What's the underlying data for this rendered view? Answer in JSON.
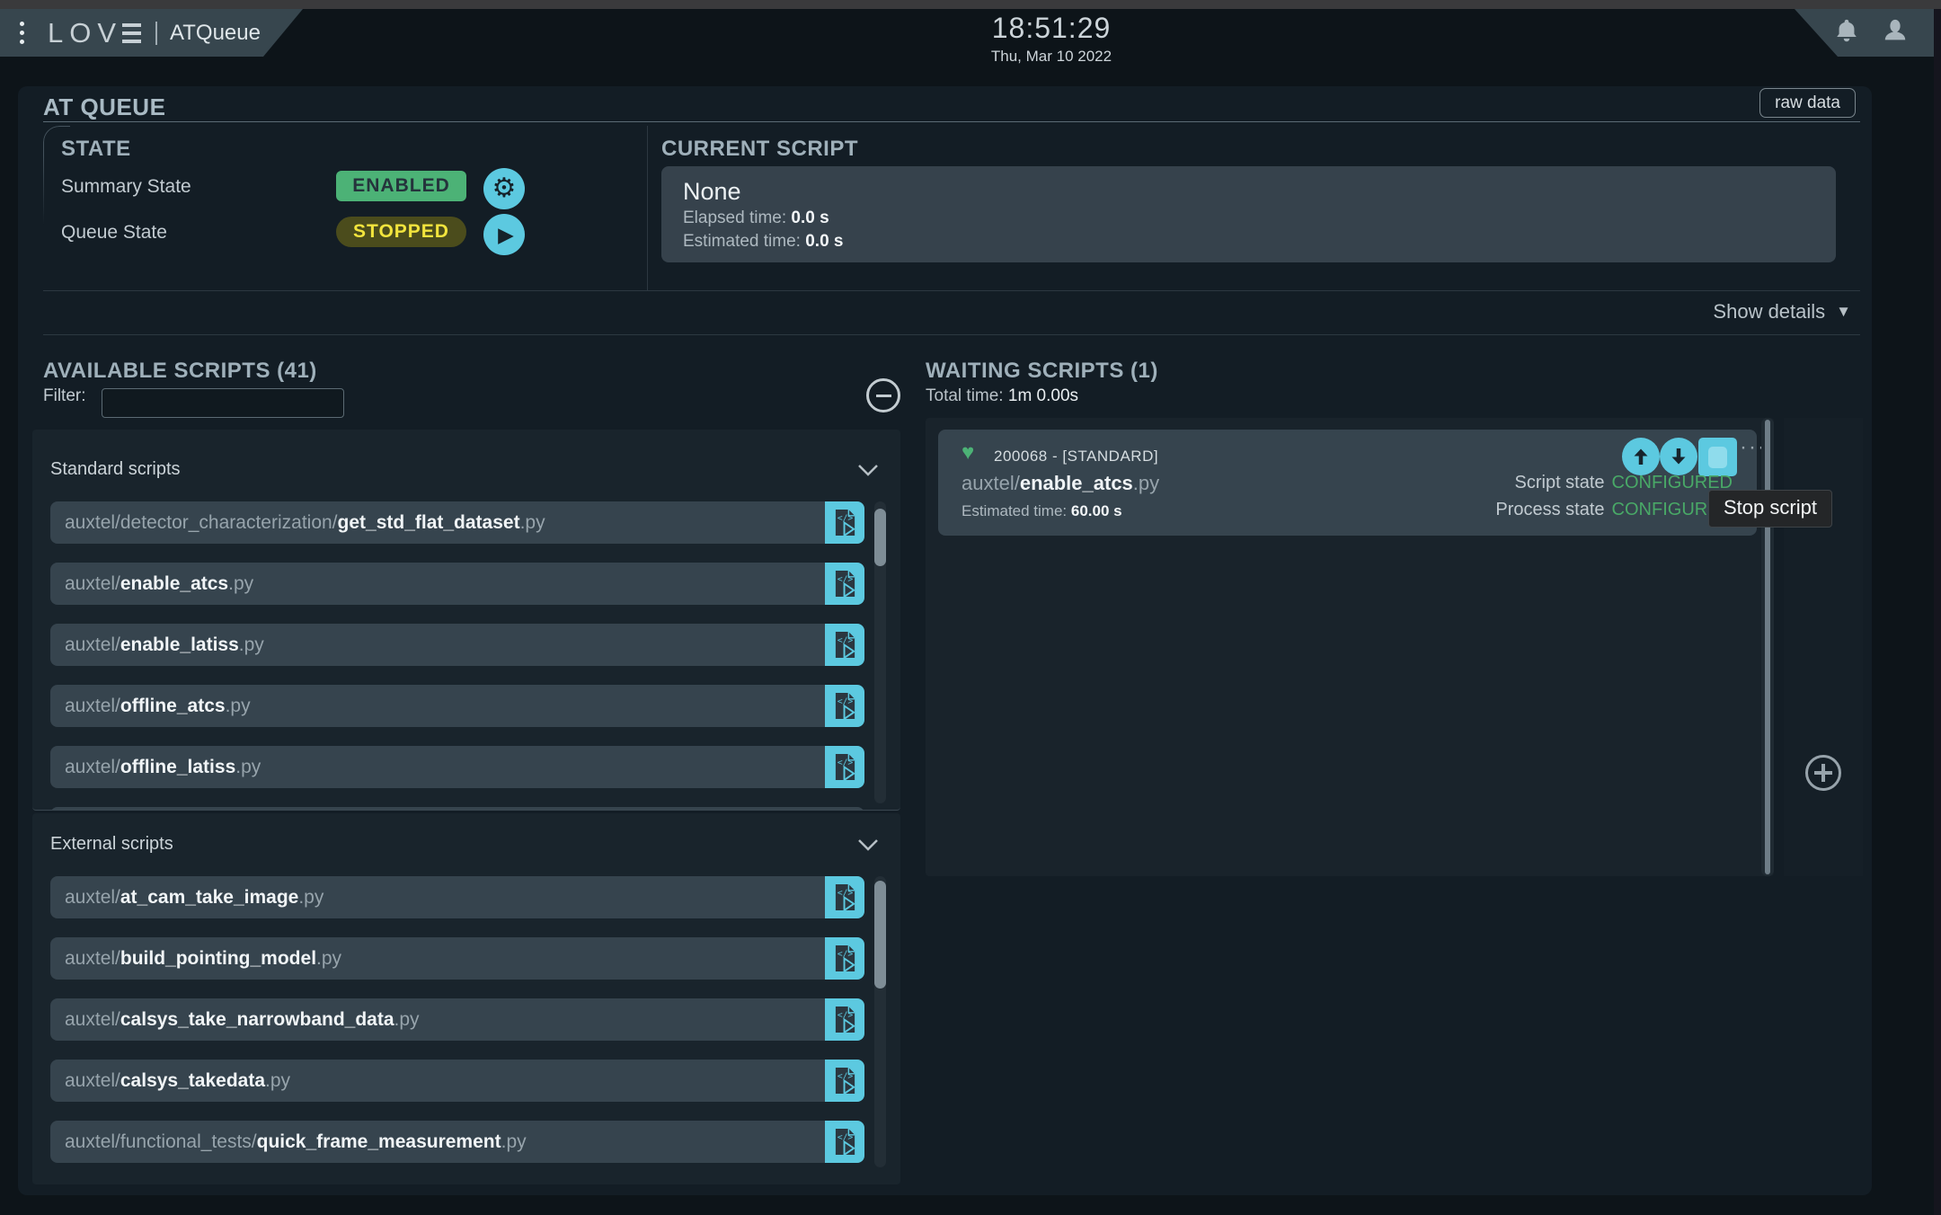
{
  "header": {
    "logo_text": "LOV",
    "app_title": "ATQueue",
    "clock_time": "18:51:29",
    "clock_date": "Thu, Mar 10 2022"
  },
  "panel": {
    "title": "AT QUEUE",
    "raw_data_label": "raw data",
    "show_details_label": "Show details",
    "show_details_arrow": "▼"
  },
  "state": {
    "heading": "STATE",
    "summary_label": "Summary State",
    "summary_value": "ENABLED",
    "queue_label": "Queue State",
    "queue_value": "STOPPED"
  },
  "current_script": {
    "heading": "CURRENT SCRIPT",
    "name": "None",
    "elapsed_label": "Elapsed time:",
    "elapsed_value": "0.0 s",
    "estimated_label": "Estimated time:",
    "estimated_value": "0.0 s"
  },
  "available": {
    "heading": "AVAILABLE SCRIPTS (41)",
    "filter_label": "Filter:",
    "filter_value": "",
    "sections": [
      {
        "label": "Standard scripts",
        "items": [
          {
            "prefix": "auxtel/detector_characterization/",
            "name": "get_std_flat_dataset",
            "ext": ".py"
          },
          {
            "prefix": "auxtel/",
            "name": "enable_atcs",
            "ext": ".py"
          },
          {
            "prefix": "auxtel/",
            "name": "enable_latiss",
            "ext": ".py"
          },
          {
            "prefix": "auxtel/",
            "name": "offline_atcs",
            "ext": ".py"
          },
          {
            "prefix": "auxtel/",
            "name": "offline_latiss",
            "ext": ".py"
          }
        ]
      },
      {
        "label": "External scripts",
        "items": [
          {
            "prefix": "auxtel/",
            "name": "at_cam_take_image",
            "ext": ".py"
          },
          {
            "prefix": "auxtel/",
            "name": "build_pointing_model",
            "ext": ".py"
          },
          {
            "prefix": "auxtel/",
            "name": "calsys_take_narrowband_data",
            "ext": ".py"
          },
          {
            "prefix": "auxtel/",
            "name": "calsys_takedata",
            "ext": ".py"
          },
          {
            "prefix": "auxtel/functional_tests/",
            "name": "quick_frame_measurement",
            "ext": ".py"
          }
        ]
      }
    ]
  },
  "waiting": {
    "heading": "WAITING SCRIPTS (1)",
    "total_label": "Total time:",
    "total_value": "1m 0.00s",
    "script": {
      "id": "200068",
      "separator": "-",
      "type": "[STANDARD]",
      "prefix": "auxtel/",
      "name": "enable_atcs",
      "ext": ".py",
      "estimated_label": "Estimated time:",
      "estimated_value": "60.00 s",
      "script_state_label": "Script state",
      "script_state": "CONFIGURED",
      "process_state_label": "Process state",
      "process_state": "CONFIGURED"
    }
  },
  "tooltip": {
    "text": "Stop script"
  },
  "colors": {
    "accent_cyan": "#5cc9e0",
    "enabled_green": "#4cb276",
    "stopped_bg": "#4b4c1c",
    "stopped_yellow": "#f2e43d",
    "configured_green": "#49a967"
  }
}
